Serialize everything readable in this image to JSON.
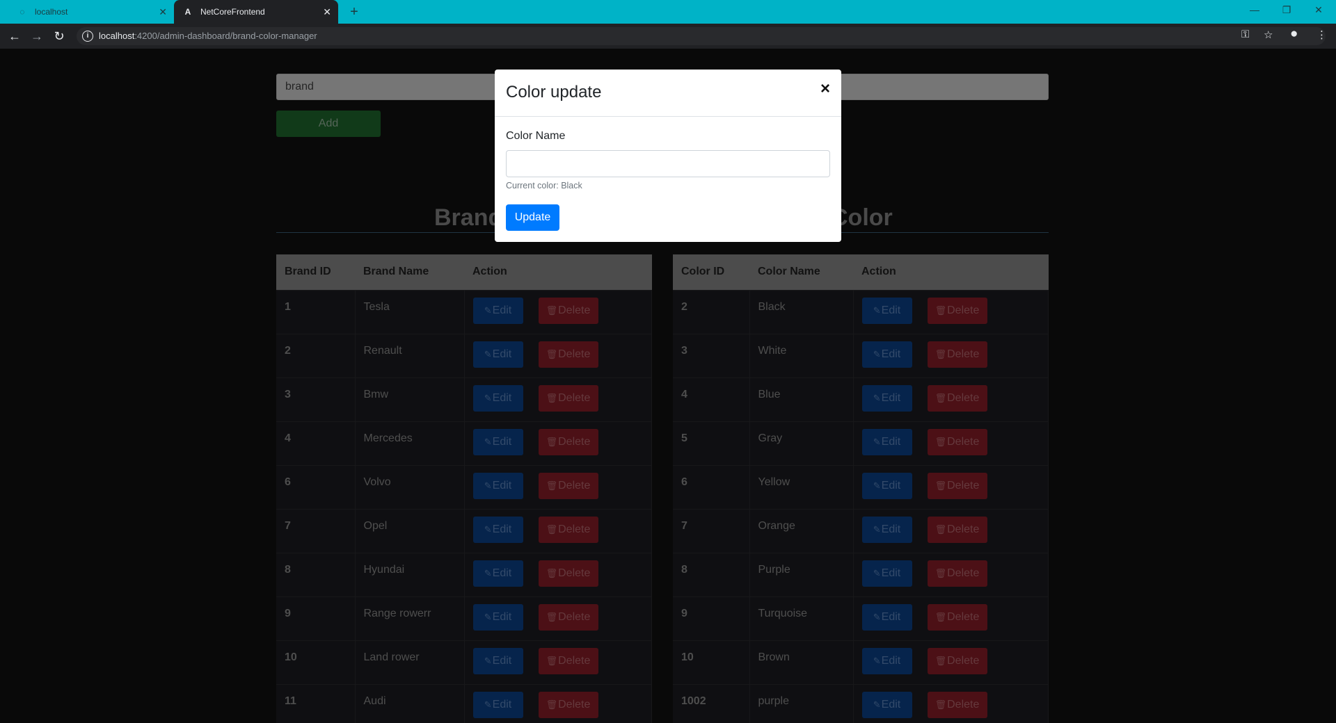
{
  "browser": {
    "tabs": [
      {
        "title": "localhost",
        "active": false
      },
      {
        "title": "NetCoreFrontend",
        "active": true
      }
    ],
    "url_host": "localhost",
    "url_path": ":4200/admin-dashboard/brand-color-manager"
  },
  "form": {
    "brand_placeholder": "brand",
    "add_label": "Add"
  },
  "headings": {
    "brand": "Brand",
    "color": "Color"
  },
  "brand_table": {
    "headers": [
      "Brand ID",
      "Brand Name",
      "Action"
    ],
    "rows": [
      {
        "id": "1",
        "name": "Tesla"
      },
      {
        "id": "2",
        "name": "Renault"
      },
      {
        "id": "3",
        "name": "Bmw"
      },
      {
        "id": "4",
        "name": "Mercedes"
      },
      {
        "id": "6",
        "name": "Volvo"
      },
      {
        "id": "7",
        "name": "Opel"
      },
      {
        "id": "8",
        "name": "Hyundai"
      },
      {
        "id": "9",
        "name": "Range rowerr"
      },
      {
        "id": "10",
        "name": "Land rower"
      },
      {
        "id": "11",
        "name": "Audi"
      }
    ]
  },
  "color_table": {
    "headers": [
      "Color ID",
      "Color Name",
      "Action"
    ],
    "rows": [
      {
        "id": "2",
        "name": "Black"
      },
      {
        "id": "3",
        "name": "White"
      },
      {
        "id": "4",
        "name": "Blue"
      },
      {
        "id": "5",
        "name": "Gray"
      },
      {
        "id": "6",
        "name": "Yellow"
      },
      {
        "id": "7",
        "name": "Orange"
      },
      {
        "id": "8",
        "name": "Purple"
      },
      {
        "id": "9",
        "name": "Turquoise"
      },
      {
        "id": "10",
        "name": "Brown"
      },
      {
        "id": "1002",
        "name": "purple"
      }
    ]
  },
  "actions": {
    "edit_label": "Edit",
    "delete_label": "Delete"
  },
  "modal": {
    "title": "Color update",
    "close_symbol": "×",
    "field_label": "Color Name",
    "field_value": "",
    "help_text": "Current color: Black",
    "submit_label": "Update"
  },
  "colors": {
    "tabbar": "#00b3c7",
    "edit": "#0c438a",
    "delete": "#8a1e28",
    "add": "#1f6a2f",
    "update": "#007bff"
  },
  "icons": {
    "edit": "pencil-square-icon",
    "delete": "trash-icon"
  }
}
